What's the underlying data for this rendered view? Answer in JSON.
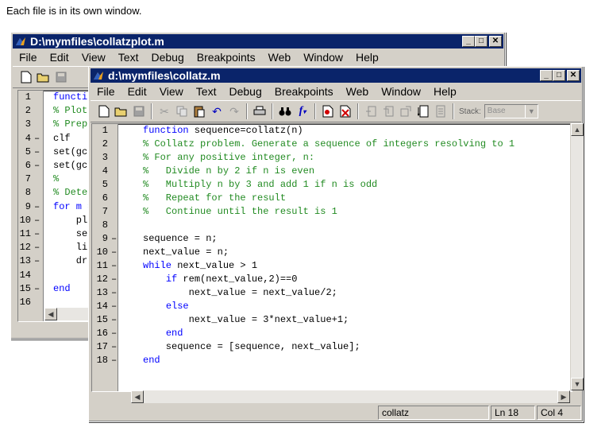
{
  "caption": "Each file is in its own window.",
  "colors": {
    "title_bar": "#0a246a",
    "keyword": "#0000ff",
    "comment": "#228b22"
  },
  "back_window": {
    "title": "D:\\mymfiles\\collatzplot.m",
    "menu": [
      "File",
      "Edit",
      "View",
      "Text",
      "Debug",
      "Breakpoints",
      "Web",
      "Window",
      "Help"
    ],
    "toolbar_icons": [
      "new-file-icon",
      "open-folder-icon",
      "save-icon"
    ],
    "lines": [
      {
        "no": "1",
        "dash": "",
        "parts": [
          {
            "t": "functio",
            "c": "kw"
          }
        ]
      },
      {
        "no": "2",
        "dash": "",
        "parts": [
          {
            "t": "% Plot",
            "c": "cm"
          }
        ]
      },
      {
        "no": "3",
        "dash": "",
        "parts": [
          {
            "t": "% Prepa",
            "c": "cm"
          }
        ]
      },
      {
        "no": "4",
        "dash": "–",
        "parts": [
          {
            "t": "clf",
            "c": ""
          }
        ]
      },
      {
        "no": "5",
        "dash": "–",
        "parts": [
          {
            "t": "set(gca",
            "c": ""
          }
        ]
      },
      {
        "no": "6",
        "dash": "–",
        "parts": [
          {
            "t": "set(gca",
            "c": ""
          }
        ]
      },
      {
        "no": "7",
        "dash": "",
        "parts": [
          {
            "t": "%",
            "c": "cm"
          }
        ]
      },
      {
        "no": "8",
        "dash": "",
        "parts": [
          {
            "t": "% Dete",
            "c": "cm"
          }
        ]
      },
      {
        "no": "9",
        "dash": "–",
        "parts": [
          {
            "t": "for m =",
            "c": "kw"
          }
        ]
      },
      {
        "no": "10",
        "dash": "–",
        "parts": [
          {
            "t": "    pl",
            "c": ""
          }
        ]
      },
      {
        "no": "11",
        "dash": "–",
        "parts": [
          {
            "t": "    se",
            "c": ""
          }
        ]
      },
      {
        "no": "12",
        "dash": "–",
        "parts": [
          {
            "t": "    li",
            "c": ""
          }
        ]
      },
      {
        "no": "13",
        "dash": "–",
        "parts": [
          {
            "t": "    dr",
            "c": ""
          }
        ]
      },
      {
        "no": "14",
        "dash": "",
        "parts": [
          {
            "t": "",
            "c": ""
          }
        ]
      },
      {
        "no": "15",
        "dash": "–",
        "parts": [
          {
            "t": "end",
            "c": "kw"
          }
        ]
      },
      {
        "no": "16",
        "dash": "",
        "parts": [
          {
            "t": "",
            "c": ""
          }
        ]
      }
    ]
  },
  "front_window": {
    "title": "d:\\mymfiles\\collatz.m",
    "menu": [
      "File",
      "Edit",
      "View",
      "Text",
      "Debug",
      "Breakpoints",
      "Web",
      "Window",
      "Help"
    ],
    "stack_label": "Stack:",
    "stack_value": "Base",
    "lines": [
      {
        "no": "1",
        "dash": "",
        "parts": [
          {
            "t": "function",
            "c": "kw"
          },
          {
            "t": " sequence=collatz(n)",
            "c": ""
          }
        ]
      },
      {
        "no": "2",
        "dash": "",
        "parts": [
          {
            "t": "% Collatz problem. Generate a sequence of integers resolving to 1",
            "c": "cm"
          }
        ]
      },
      {
        "no": "3",
        "dash": "",
        "parts": [
          {
            "t": "% For any positive integer, n:",
            "c": "cm"
          }
        ]
      },
      {
        "no": "4",
        "dash": "",
        "parts": [
          {
            "t": "%   Divide n by 2 if n is even",
            "c": "cm"
          }
        ]
      },
      {
        "no": "5",
        "dash": "",
        "parts": [
          {
            "t": "%   Multiply n by 3 and add 1 if n is odd",
            "c": "cm"
          }
        ]
      },
      {
        "no": "6",
        "dash": "",
        "parts": [
          {
            "t": "%   Repeat for the result",
            "c": "cm"
          }
        ]
      },
      {
        "no": "7",
        "dash": "",
        "parts": [
          {
            "t": "%   Continue until the result is 1",
            "c": "cm"
          }
        ]
      },
      {
        "no": "8",
        "dash": "",
        "parts": [
          {
            "t": "",
            "c": ""
          }
        ]
      },
      {
        "no": "9",
        "dash": "–",
        "parts": [
          {
            "t": "sequence = n;",
            "c": ""
          }
        ]
      },
      {
        "no": "10",
        "dash": "–",
        "parts": [
          {
            "t": "next_value = n;",
            "c": ""
          }
        ]
      },
      {
        "no": "11",
        "dash": "–",
        "parts": [
          {
            "t": "while",
            "c": "kw"
          },
          {
            "t": " next_value > 1",
            "c": ""
          }
        ]
      },
      {
        "no": "12",
        "dash": "–",
        "parts": [
          {
            "t": "    ",
            "c": ""
          },
          {
            "t": "if",
            "c": "kw"
          },
          {
            "t": " rem(next_value,2)==0",
            "c": ""
          }
        ]
      },
      {
        "no": "13",
        "dash": "–",
        "parts": [
          {
            "t": "        next_value = next_value/2;",
            "c": ""
          }
        ]
      },
      {
        "no": "14",
        "dash": "–",
        "parts": [
          {
            "t": "    ",
            "c": ""
          },
          {
            "t": "else",
            "c": "kw"
          }
        ]
      },
      {
        "no": "15",
        "dash": "–",
        "parts": [
          {
            "t": "        next_value = 3*next_value+1;",
            "c": ""
          }
        ]
      },
      {
        "no": "16",
        "dash": "–",
        "parts": [
          {
            "t": "    ",
            "c": ""
          },
          {
            "t": "end",
            "c": "kw"
          }
        ]
      },
      {
        "no": "17",
        "dash": "–",
        "parts": [
          {
            "t": "    sequence = [sequence, next_value];",
            "c": ""
          }
        ]
      },
      {
        "no": "18",
        "dash": "–",
        "parts": [
          {
            "t": "end",
            "c": "kw"
          }
        ]
      }
    ],
    "status": {
      "function_name": "collatz",
      "line": "Ln 18",
      "col": "Col 4"
    }
  }
}
